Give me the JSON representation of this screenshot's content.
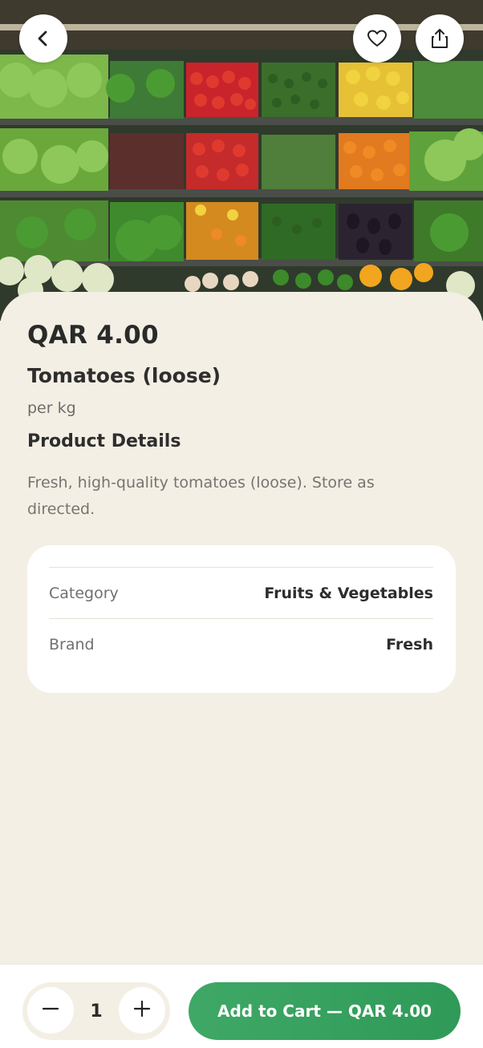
{
  "header": {
    "back_icon": "chevron-left-icon",
    "favorite_icon": "heart-icon",
    "share_icon": "share-icon"
  },
  "product": {
    "price": "QAR 4.00",
    "name": "Tomatoes (loose)",
    "unit": "per kg",
    "details_title": "Product Details",
    "description": "Fresh, high-quality tomatoes (loose). Store as directed.",
    "attributes": [
      {
        "label": "Category",
        "value": "Fruits & Vegetables"
      },
      {
        "label": "Brand",
        "value": "Fresh"
      }
    ]
  },
  "cart": {
    "quantity": "1",
    "add_button_label": "Add to Cart — QAR 4.00",
    "minus_icon": "minus-icon",
    "plus_icon": "plus-icon",
    "accent_color": "#34a15f"
  }
}
